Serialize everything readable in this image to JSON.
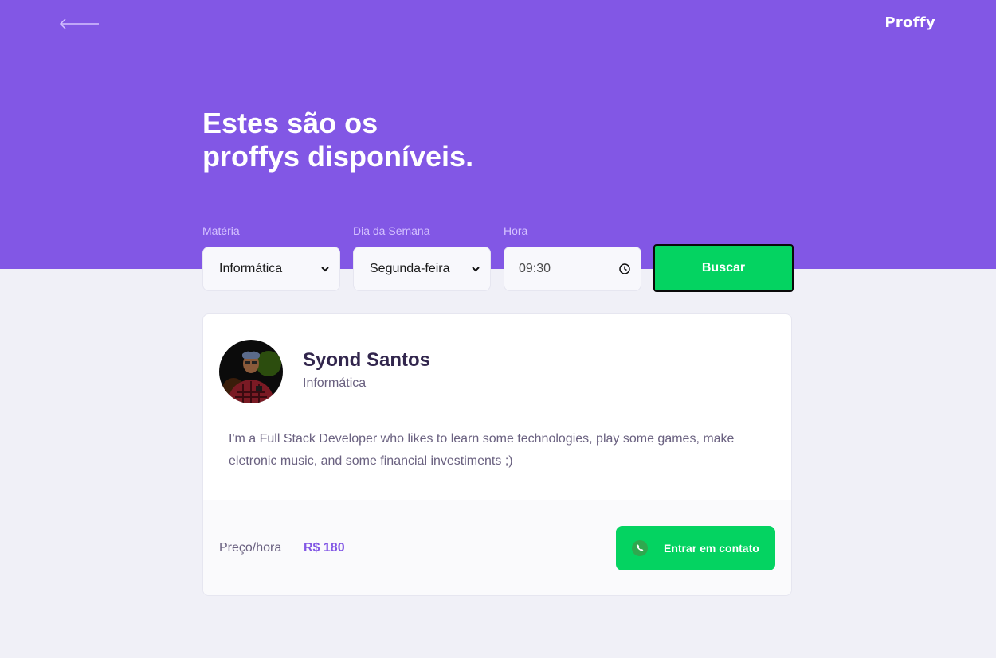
{
  "app": {
    "logo": "Proffy",
    "back_icon": "arrow-left-icon"
  },
  "header": {
    "title_line1": "Estes são os",
    "title_line2": "proffys disponíveis."
  },
  "filters": {
    "subject": {
      "label": "Matéria",
      "value": "Informática"
    },
    "weekday": {
      "label": "Dia da Semana",
      "value": "Segunda-feira"
    },
    "time": {
      "label": "Hora",
      "value": "09:30"
    },
    "search_label": "Buscar"
  },
  "teacher": {
    "name": "Syond Santos",
    "subject": "Informática",
    "bio": "I'm a Full Stack Developer who likes to learn some technologies, play some games, make eletronic music, and some financial investiments ;)",
    "price_label": "Preço/hora",
    "price_value": "R$ 180",
    "contact_label": "Entrar em contato",
    "contact_icon": "whatsapp-icon"
  },
  "colors": {
    "primary": "#8257E5",
    "secondary": "#04D361",
    "background": "#F0F0F7",
    "title_dark": "#32264D",
    "text": "#6A6180"
  }
}
